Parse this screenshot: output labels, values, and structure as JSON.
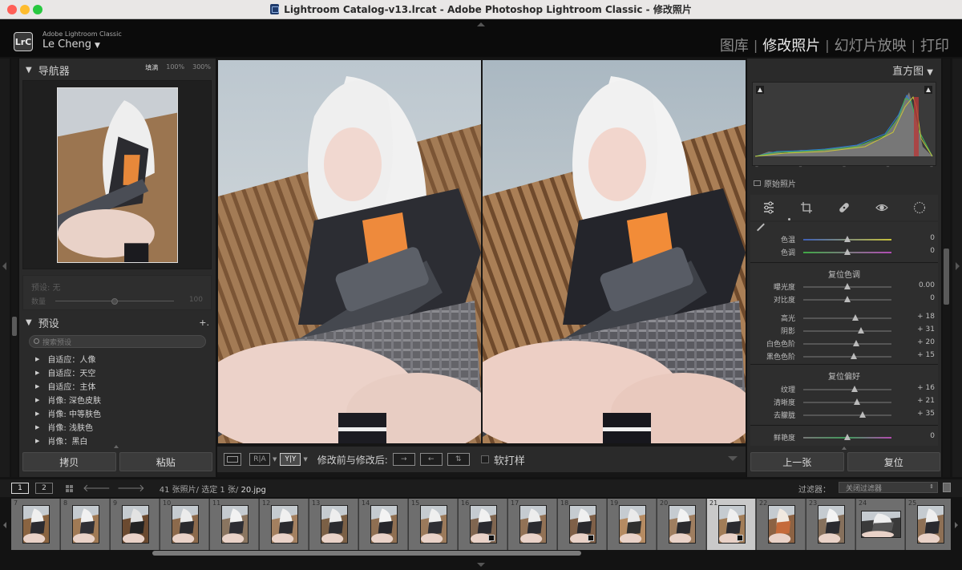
{
  "window": {
    "title": "Lightroom Catalog-v13.lrcat - Adobe Photoshop Lightroom Classic - 修改照片"
  },
  "identity": {
    "logo": "LrC",
    "brand": "Adobe Lightroom Classic",
    "user": "Le Cheng",
    "user_caret": "▼"
  },
  "modules": {
    "library": "图库",
    "develop": "修改照片",
    "slideshow": "幻灯片放映",
    "print": "打印",
    "separator": "|"
  },
  "navigator": {
    "title": "导航器",
    "zoom_fit": "填满",
    "zoom_100": "100%",
    "zoom_300": "300%"
  },
  "preset_amount": {
    "label": "预设: 无",
    "amount_label": "数量",
    "amount_value": "100"
  },
  "presets": {
    "title": "预设",
    "add": "+.",
    "search_placeholder": "搜索预设",
    "items": [
      "自适应：人像",
      "自适应：天空",
      "自适应：主体",
      "肖像: 深色皮肤",
      "肖像: 中等肤色",
      "肖像: 浅肤色",
      "肖像：黑白"
    ]
  },
  "left_buttons": {
    "copy": "拷贝",
    "paste": "粘贴"
  },
  "toolbar": {
    "ra": "R|A",
    "yy": "Y|Y",
    "before_after": "修改前与修改后:",
    "soft_proof": "软打样"
  },
  "histogram": {
    "title": "直方图",
    "original_photo": "原始照片",
    "dash": "–"
  },
  "develop": {
    "wb": [
      {
        "name": "色温",
        "value": "0",
        "pos": 0.5
      },
      {
        "name": "色调",
        "value": "0",
        "pos": 0.5
      }
    ],
    "tone_title": "复位色调",
    "tone": [
      {
        "name": "曝光度",
        "value": "0.00",
        "pos": 0.5
      },
      {
        "name": "对比度",
        "value": "0",
        "pos": 0.5
      },
      {
        "name": "高光",
        "value": "+ 18",
        "pos": 0.59
      },
      {
        "name": "阴影",
        "value": "+ 31",
        "pos": 0.655
      },
      {
        "name": "白色色阶",
        "value": "+ 20",
        "pos": 0.6
      },
      {
        "name": "黑色色阶",
        "value": "+ 15",
        "pos": 0.575
      }
    ],
    "presence_title": "复位偏好",
    "presence": [
      {
        "name": "纹理",
        "value": "+ 16",
        "pos": 0.58
      },
      {
        "name": "清晰度",
        "value": "+ 21",
        "pos": 0.605
      },
      {
        "name": "去朦胧",
        "value": "+ 35",
        "pos": 0.675
      }
    ],
    "vibrance": {
      "name": "鲜艳度",
      "value": "0",
      "pos": 0.5
    }
  },
  "right_buttons": {
    "previous": "上一张",
    "reset": "复位"
  },
  "filterbar": {
    "page1": "1",
    "page2": "2",
    "count": "41 张照片/ 选定 1 张/",
    "filename": "20.jpg",
    "filter_label": "过滤器：",
    "filter_value": "关闭过滤器"
  },
  "filmstrip": {
    "numbers": [
      "7",
      "8",
      "9",
      "10",
      "11",
      "12",
      "13",
      "14",
      "15",
      "16",
      "17",
      "18",
      "19",
      "20",
      "21",
      "22",
      "23",
      "24",
      "25"
    ],
    "selected_index": 14
  },
  "colors": {
    "accent_panel": "#2a2a2a",
    "selected_cell": "#c9c9c9",
    "active_module": "#e8e8e8"
  }
}
